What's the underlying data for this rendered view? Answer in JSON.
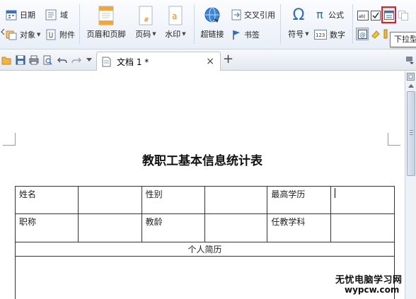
{
  "ribbon": {
    "date_label": "日期",
    "field_label": "域",
    "object_label": "对象",
    "attachment_label": "附件",
    "header_footer_label": "页眉和页脚",
    "page_number_label": "页码",
    "watermark_label": "水印",
    "hyperlink_label": "超链接",
    "cross_reference_label": "交叉引用",
    "bookmark_label": "书签",
    "symbol_label": "符号",
    "formula_label": "公式",
    "number_label": "数字",
    "tooltip_label": "下拉型"
  },
  "tabbar": {
    "document_tab": "文档 1 *",
    "close_glyph": "×",
    "new_tab_glyph": "+"
  },
  "document": {
    "title": "教职工基本信息统计表",
    "rows": [
      [
        "姓名",
        "",
        "性别",
        "",
        "最高学历",
        ""
      ],
      [
        "职称",
        "",
        "教龄",
        "",
        "任教学科",
        ""
      ]
    ],
    "resume_header": "个人简历"
  },
  "watermark": {
    "line1": "无忧电脑学习网",
    "line2": "wypcw.com"
  },
  "colors": {
    "ribbon_bg": "#e9eff7",
    "highlight_red": "#e8192c",
    "accent_blue": "#2b6cc4",
    "icon_orange": "#f4a63a"
  }
}
